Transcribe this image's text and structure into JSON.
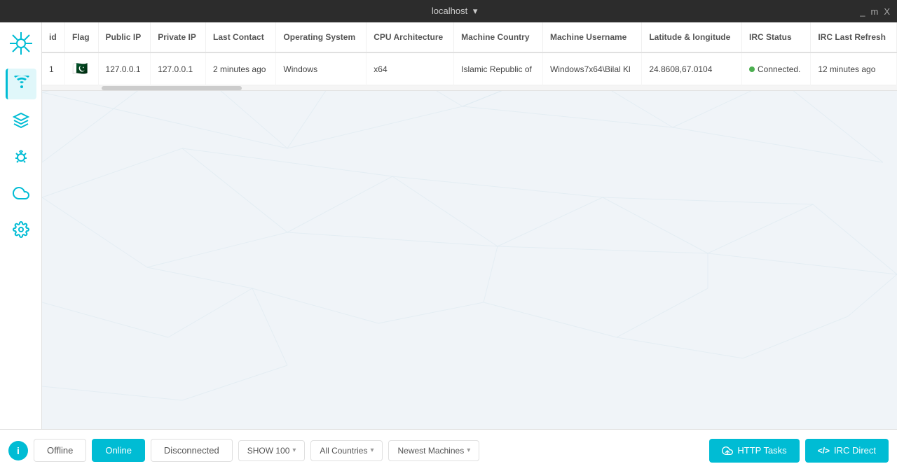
{
  "titleBar": {
    "title": "localhost",
    "dropdownArrow": "▾",
    "minimize": "_",
    "maximize": "m",
    "close": "X"
  },
  "sidebar": {
    "items": [
      {
        "id": "logo",
        "icon": "✦",
        "label": "logo-icon"
      },
      {
        "id": "wireless",
        "icon": "wireless",
        "label": "wireless-icon",
        "active": true
      },
      {
        "id": "layers",
        "icon": "layers",
        "label": "layers-icon"
      },
      {
        "id": "bug",
        "icon": "bug",
        "label": "bug-icon"
      },
      {
        "id": "cloud",
        "icon": "cloud",
        "label": "cloud-icon"
      },
      {
        "id": "settings",
        "icon": "settings",
        "label": "settings-icon"
      }
    ]
  },
  "table": {
    "columns": [
      "id",
      "Flag",
      "Public IP",
      "Private IP",
      "Last Contact",
      "Operating System",
      "CPU Architecture",
      "Machine Country",
      "Machine Username",
      "Latitude & longitude",
      "IRC Status",
      "IRC Last Refresh"
    ],
    "rows": [
      {
        "id": "1",
        "flag": "🇵🇰",
        "publicIp": "127.0.0.1",
        "privateIp": "127.0.0.1",
        "lastContact": "2 minutes ago",
        "os": "Windows",
        "cpuArch": "x64",
        "country": "Islamic Republic of",
        "username": "Windows7x64\\Bilal Kl",
        "latlong": "24.8608,67.0104",
        "ircStatus": "Connected.",
        "ircLastRefresh": "12 minutes ago"
      }
    ]
  },
  "bottomBar": {
    "tabs": [
      {
        "id": "offline",
        "label": "Offline",
        "active": false
      },
      {
        "id": "online",
        "label": "Online",
        "active": true
      },
      {
        "id": "disconnected",
        "label": "Disconnected",
        "active": false
      }
    ],
    "dropdowns": [
      {
        "id": "show",
        "label": "SHOW 100",
        "arrow": "▾"
      },
      {
        "id": "countries",
        "label": "All Countries",
        "arrow": "▾"
      },
      {
        "id": "sort",
        "label": "Newest Machines",
        "arrow": "▾"
      }
    ],
    "buttons": [
      {
        "id": "http-tasks",
        "icon": "☁",
        "label": "HTTP Tasks"
      },
      {
        "id": "irc-direct",
        "icon": "</>",
        "label": "IRC Direct"
      }
    ],
    "infoIcon": "i"
  }
}
